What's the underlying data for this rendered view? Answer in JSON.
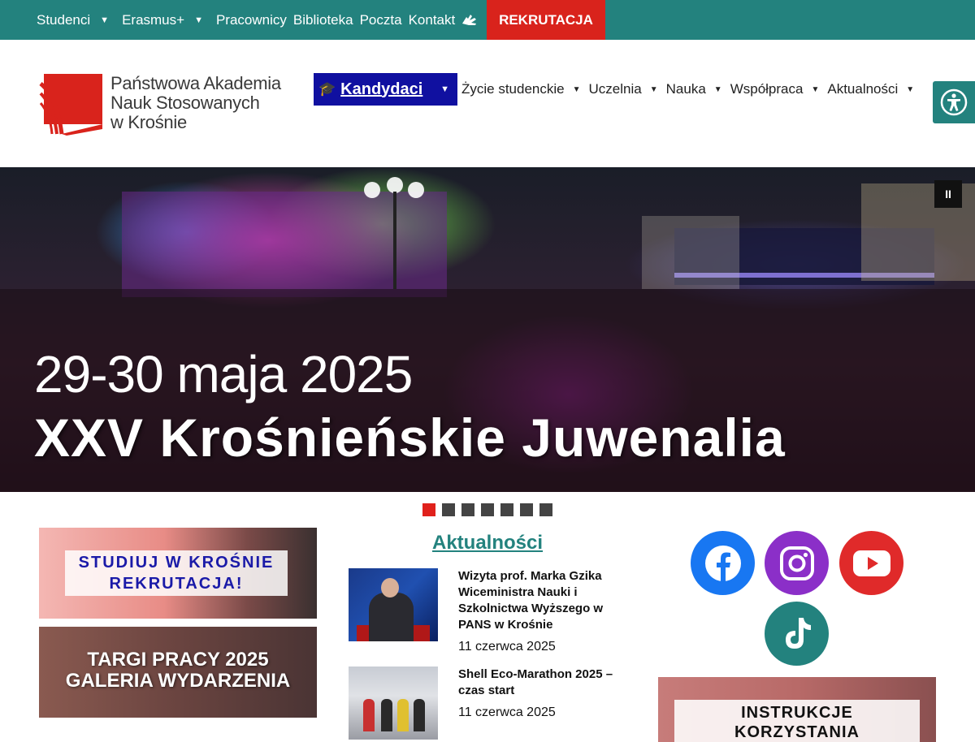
{
  "topbar": {
    "items": [
      {
        "label": "Studenci",
        "has_dropdown": true
      },
      {
        "label": "Erasmus+",
        "has_dropdown": true
      },
      {
        "label": "Pracownicy",
        "has_dropdown": false
      },
      {
        "label": "Biblioteka",
        "has_dropdown": false
      },
      {
        "label": "Poczta",
        "has_dropdown": false
      },
      {
        "label": "Kontakt",
        "has_dropdown": false
      }
    ],
    "accessibility_icon": "sign-language-icon",
    "cta_label": "REKRUTACJA",
    "background_color": "#23827e",
    "cta_color": "#d9231c"
  },
  "logo": {
    "lines": [
      "Państwowa Akademia",
      "Nauk Stosowanych",
      "w Krośnie"
    ]
  },
  "mainnav": {
    "highlight": {
      "label": "Kandydaci",
      "icon": "graduation-cap-icon",
      "color": "#1010a0"
    },
    "items": [
      {
        "label": "Życie studenckie"
      },
      {
        "label": "Uczelnia"
      },
      {
        "label": "Nauka"
      },
      {
        "label": "Współpraca"
      },
      {
        "label": "Aktualności"
      }
    ],
    "accessibility_button_icon": "accessibility-icon"
  },
  "hero": {
    "date_line": "29-30 maja 2025",
    "title_line": "XXV Krośnieńskie Juwenalia",
    "pause_label": "II",
    "slides_count": 7,
    "active_slide": 1
  },
  "banners": {
    "recruitment": {
      "line1": "STUDIUJ W KROŚNIE",
      "line2": "REKRUTACJA!"
    },
    "gallery": {
      "line1": "TARGI PRACY 2025",
      "line2": "GALERIA WYDARZENIA"
    }
  },
  "news": {
    "title": "Aktualności",
    "items": [
      {
        "title": "Wizyta prof. Marka Gzika Wiceministra Nauki i Szkolnictwa Wyższego w PANS w Krośnie",
        "date": "11 czerwca 2025"
      },
      {
        "title": "Shell Eco-Marathon 2025 – czas start",
        "date": "11 czerwca 2025"
      }
    ]
  },
  "social": {
    "icons": [
      "facebook-icon",
      "instagram-icon",
      "youtube-icon",
      "tiktok-icon"
    ],
    "colors": {
      "facebook": "#1877f2",
      "instagram": "#8b2fc8",
      "youtube": "#e02a2a",
      "tiktok": "#23827e"
    }
  },
  "instructions": {
    "line1": "INSTRUKCJE",
    "line2": "KORZYSTANIA"
  }
}
